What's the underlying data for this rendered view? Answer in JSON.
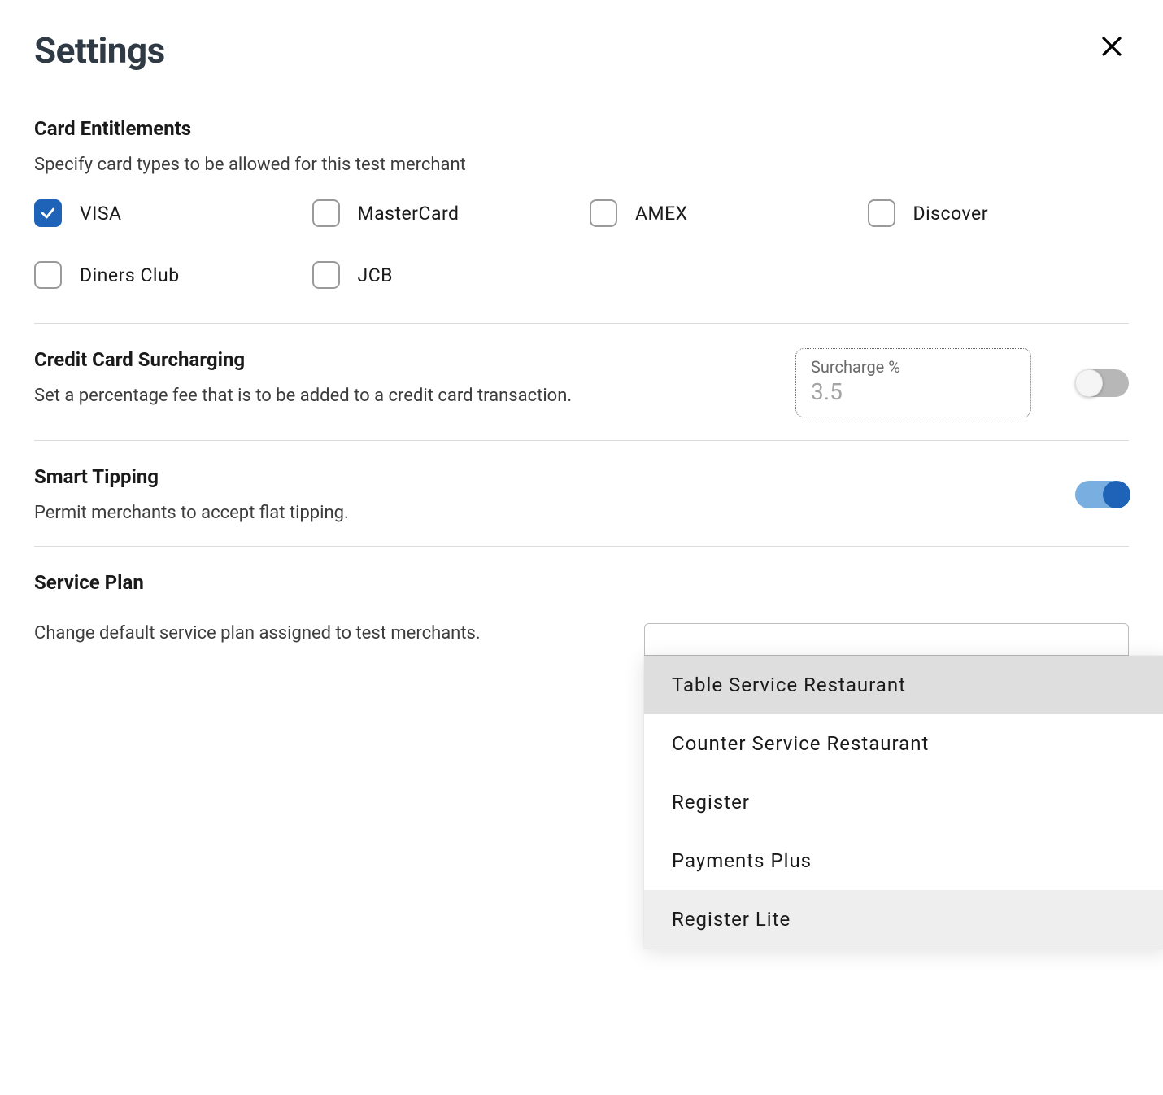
{
  "title": "Settings",
  "card_entitlements": {
    "heading": "Card Entitlements",
    "description": "Specify card types to be allowed for this test merchant",
    "options": [
      {
        "label": "VISA",
        "checked": true
      },
      {
        "label": "MasterCard",
        "checked": false
      },
      {
        "label": "AMEX",
        "checked": false
      },
      {
        "label": "Discover",
        "checked": false
      },
      {
        "label": "Diners Club",
        "checked": false
      },
      {
        "label": "JCB",
        "checked": false
      }
    ]
  },
  "surcharging": {
    "heading": "Credit Card Surcharging",
    "description": "Set a percentage fee that is to be added to a credit card transaction.",
    "field_label": "Surcharge %",
    "placeholder": "3.5",
    "enabled": false
  },
  "smart_tipping": {
    "heading": "Smart Tipping",
    "description": "Permit merchants to accept flat tipping.",
    "enabled": true
  },
  "service_plan": {
    "heading": "Service Plan",
    "description": "Change default service plan assigned to test merchants.",
    "options": [
      {
        "label": "Table Service Restaurant",
        "highlighted": true
      },
      {
        "label": "Counter Service Restaurant",
        "highlighted": false
      },
      {
        "label": "Register",
        "highlighted": false
      },
      {
        "label": "Payments Plus",
        "highlighted": false
      },
      {
        "label": "Register Lite",
        "highlighted": false,
        "hover": true
      }
    ]
  }
}
